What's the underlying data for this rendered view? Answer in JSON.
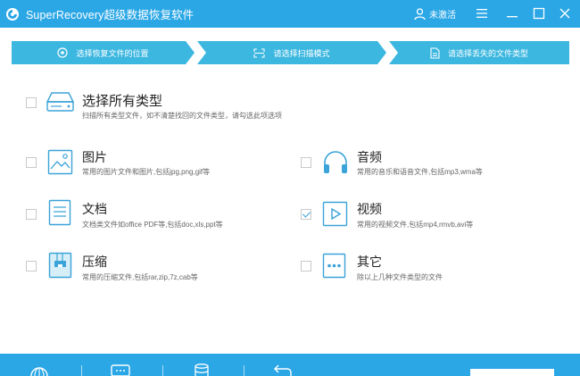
{
  "titlebar": {
    "app_title": "SuperRecovery超级数据恢复软件",
    "user_status": "未激活",
    "icons": [
      "app-logo-icon",
      "user-icon",
      "menu-icon",
      "minimize-icon",
      "maximize-icon",
      "close-icon"
    ]
  },
  "steps": [
    {
      "label": "选择恢复文件的位置",
      "icon": "location-icon"
    },
    {
      "label": "请选择扫描模式",
      "icon": "scan-icon"
    },
    {
      "label": "请选择丢失的文件类型",
      "icon": "file-icon"
    }
  ],
  "options": {
    "all": {
      "title": "选择所有类型",
      "desc": "扫描所有类型文件，如不清楚找回的文件类型，请勾选此项选项",
      "checked": false,
      "icon": "drive-icon"
    },
    "image": {
      "title": "图片",
      "desc": "常用的图片文件和图片,包括jpg,png,gif等",
      "checked": false,
      "icon": "image-icon"
    },
    "audio": {
      "title": "音频",
      "desc": "常用的音乐和语音文件,包括mp3,wma等",
      "checked": false,
      "icon": "headphones-icon"
    },
    "document": {
      "title": "文档",
      "desc": "文档类文件如office PDF等,包括doc,xls,ppt等",
      "checked": false,
      "icon": "document-icon"
    },
    "video": {
      "title": "视频",
      "desc": "常用的视频文件,包括mp4,rmvb,avi等",
      "checked": true,
      "icon": "video-icon"
    },
    "archive": {
      "title": "压缩",
      "desc": "常用的压缩文件,包括rar,zip,7z,cab等",
      "checked": false,
      "icon": "archive-icon"
    },
    "other": {
      "title": "其它",
      "desc": "除以上几种文件类型的文件",
      "checked": false,
      "icon": "more-icon"
    }
  },
  "colors": {
    "primary": "#2ba7e6",
    "step": "#3cb7e0",
    "icon": "#3aa3d8"
  },
  "bottombar": {
    "icons": [
      "globe-icon",
      "chat-icon",
      "database-icon",
      "back-icon"
    ]
  }
}
